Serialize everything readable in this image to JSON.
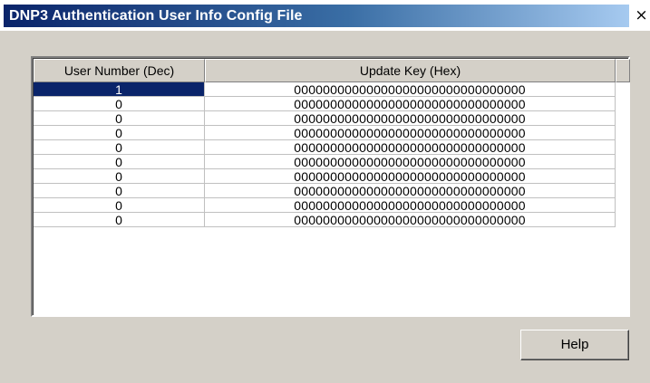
{
  "window": {
    "title": "DNP3 Authentication User Info Config File",
    "close_glyph": "×"
  },
  "table": {
    "columns": [
      "User Number (Dec)",
      "Update Key (Hex)"
    ],
    "rows": [
      {
        "user_number": "1",
        "update_key": "00000000000000000000000000000000",
        "selected": true
      },
      {
        "user_number": "0",
        "update_key": "00000000000000000000000000000000",
        "selected": false
      },
      {
        "user_number": "0",
        "update_key": "00000000000000000000000000000000",
        "selected": false
      },
      {
        "user_number": "0",
        "update_key": "00000000000000000000000000000000",
        "selected": false
      },
      {
        "user_number": "0",
        "update_key": "00000000000000000000000000000000",
        "selected": false
      },
      {
        "user_number": "0",
        "update_key": "00000000000000000000000000000000",
        "selected": false
      },
      {
        "user_number": "0",
        "update_key": "00000000000000000000000000000000",
        "selected": false
      },
      {
        "user_number": "0",
        "update_key": "00000000000000000000000000000000",
        "selected": false
      },
      {
        "user_number": "0",
        "update_key": "00000000000000000000000000000000",
        "selected": false
      },
      {
        "user_number": "0",
        "update_key": "00000000000000000000000000000000",
        "selected": false
      }
    ]
  },
  "buttons": {
    "help_label": "Help"
  },
  "colors": {
    "title_bar": "#0a246a",
    "selection": "#0a246a",
    "dialog_face": "#d4d0c8"
  }
}
